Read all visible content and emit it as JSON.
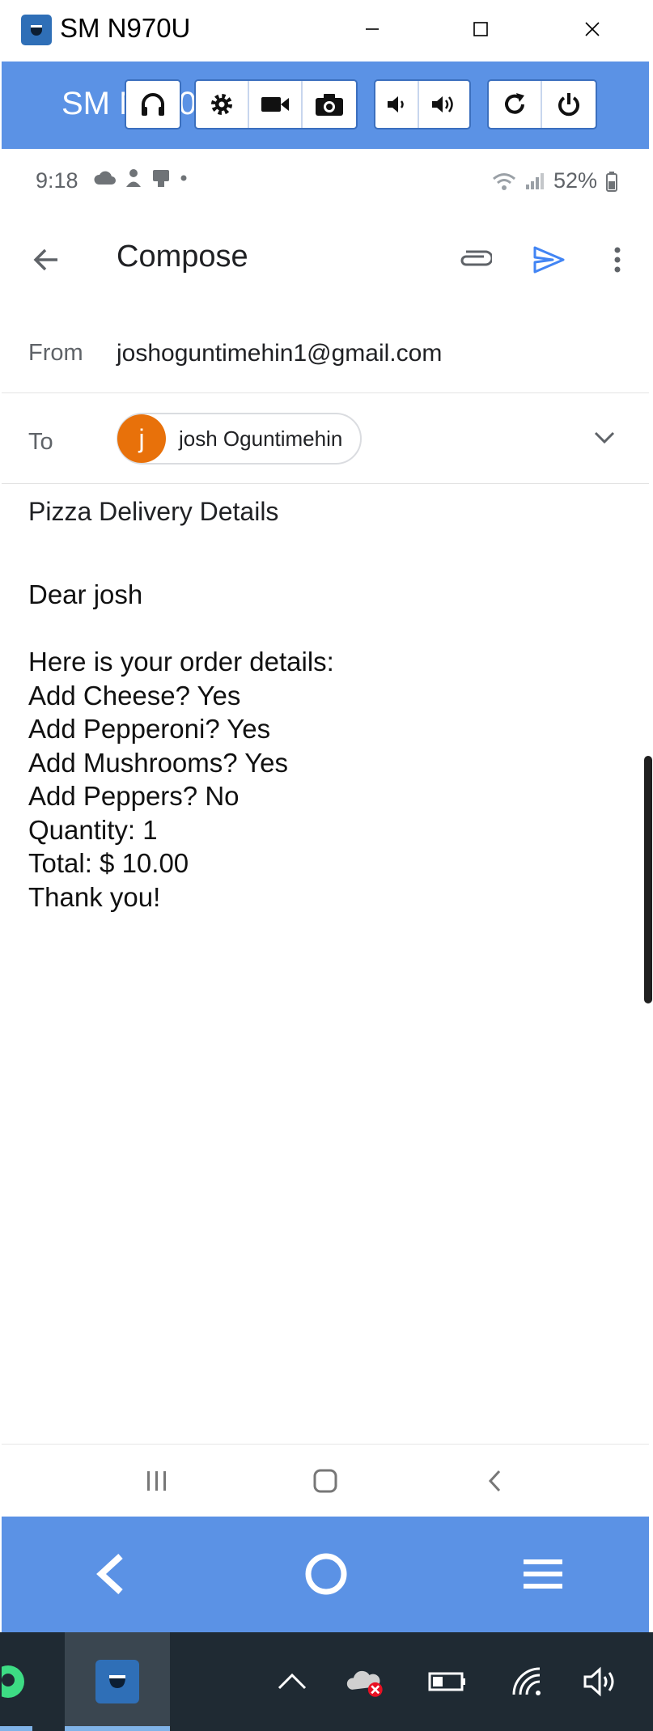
{
  "window": {
    "title": "SM N970U",
    "minimize_icon": "minimize-icon",
    "maximize_icon": "maximize-icon",
    "close_icon": "close-icon"
  },
  "toolbar": {
    "device_label": "SM N970U",
    "groups": [
      [
        "headphones-icon"
      ],
      [
        "gear-icon",
        "video-camera-icon",
        "camera-icon"
      ],
      [
        "volume-down-icon",
        "volume-up-icon"
      ],
      [
        "rotate-icon",
        "power-icon"
      ]
    ],
    "accent_color": "#5b92e5"
  },
  "statusbar": {
    "time": "9:18",
    "battery": "52%"
  },
  "compose": {
    "title": "Compose",
    "from_label": "From",
    "from_value": "joshoguntimehin1@gmail.com",
    "to_label": "To",
    "recipient_initial": "j",
    "recipient_name": "josh Oguntimehin",
    "recipient_color": "#e8710a",
    "subject": "Pizza Delivery Details",
    "body_lines": [
      "Dear josh",
      "",
      "Here is your order details:",
      "Add Cheese? Yes",
      "Add Pepperoni? Yes",
      "Add Mushrooms? Yes",
      "Add Peppers? No",
      "Quantity: 1",
      "Total: $ 10.00",
      "Thank you!"
    ],
    "send_color": "#4285f4"
  },
  "android_nav": [
    "recent-apps-icon",
    "home-icon",
    "back-icon"
  ],
  "scrcpy_nav": [
    "back-icon",
    "home-icon",
    "menu-icon"
  ]
}
